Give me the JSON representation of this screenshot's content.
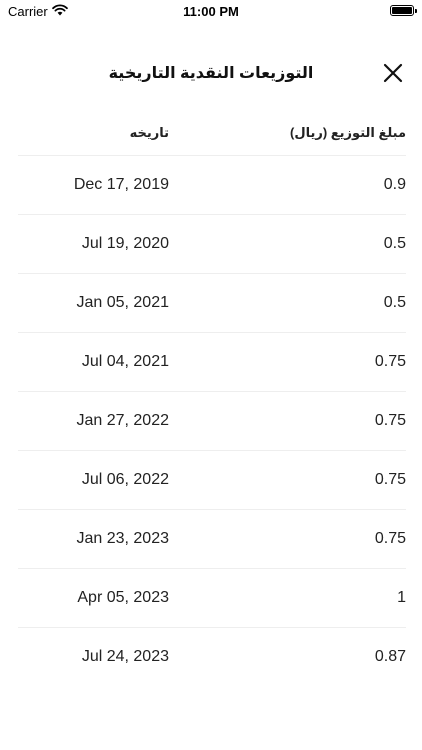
{
  "status_bar": {
    "carrier": "Carrier",
    "time": "11:00 PM",
    "battery_level": 1.0
  },
  "header": {
    "title": "التوزيعات النقدية التاريخية",
    "close_icon": "close-icon"
  },
  "table": {
    "columns": {
      "amount": "مبلغ التوزيع (ريال)",
      "date": "تاريخه"
    },
    "rows": [
      {
        "date": "Dec 17, 2019",
        "amount": "0.9"
      },
      {
        "date": "Jul 19, 2020",
        "amount": "0.5"
      },
      {
        "date": "Jan 05, 2021",
        "amount": "0.5"
      },
      {
        "date": "Jul 04, 2021",
        "amount": "0.75"
      },
      {
        "date": "Jan 27, 2022",
        "amount": "0.75"
      },
      {
        "date": "Jul 06, 2022",
        "amount": "0.75"
      },
      {
        "date": "Jan 23, 2023",
        "amount": "0.75"
      },
      {
        "date": "Apr 05, 2023",
        "amount": "1"
      },
      {
        "date": "Jul 24, 2023",
        "amount": "0.87"
      }
    ]
  }
}
